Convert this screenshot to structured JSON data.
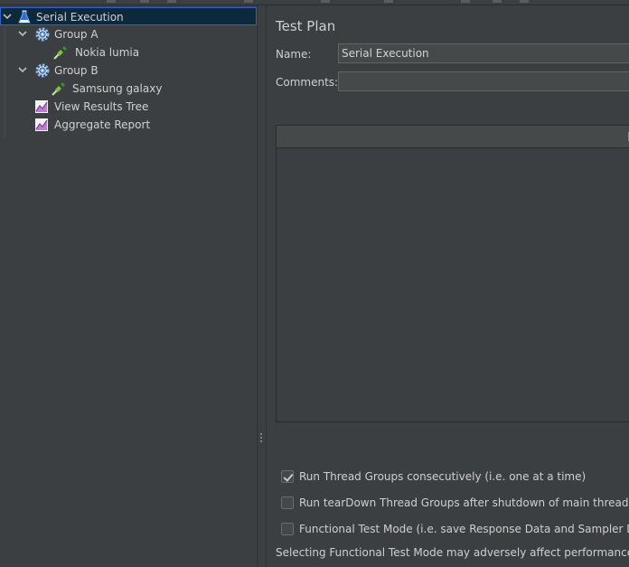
{
  "tree": {
    "items": [
      {
        "label": "Serial Execution",
        "icon": "test-plan-flask-icon"
      },
      {
        "label": "Group A",
        "icon": "thread-group-gear-icon"
      },
      {
        "label": "Nokia lumia",
        "icon": "sampler-pipette-icon"
      },
      {
        "label": "Group B",
        "icon": "thread-group-gear-icon"
      },
      {
        "label": "Samsung galaxy",
        "icon": "sampler-pipette-icon"
      },
      {
        "label": "View Results Tree",
        "icon": "listener-chart-icon"
      },
      {
        "label": "Aggregate Report",
        "icon": "listener-chart-icon"
      }
    ]
  },
  "main": {
    "title": "Test Plan",
    "name_label": "Name:",
    "name_value": "Serial Execution",
    "comments_label": "Comments:",
    "comments_value": "",
    "options": [
      {
        "label": "Run Thread Groups consecutively (i.e. one at a time)",
        "checked": true
      },
      {
        "label": "Run tearDown Thread Groups after shutdown of main threads",
        "checked": false
      },
      {
        "label": "Functional Test Mode (i.e. save Response Data and Sampler Data)",
        "checked": false
      }
    ],
    "note": "Selecting Functional Test Mode may adversely affect performance."
  },
  "colors": {
    "background": "#3c3f41",
    "selection": "#0d293e",
    "selection_border": "#2f65ca",
    "field_background": "#45494a"
  }
}
